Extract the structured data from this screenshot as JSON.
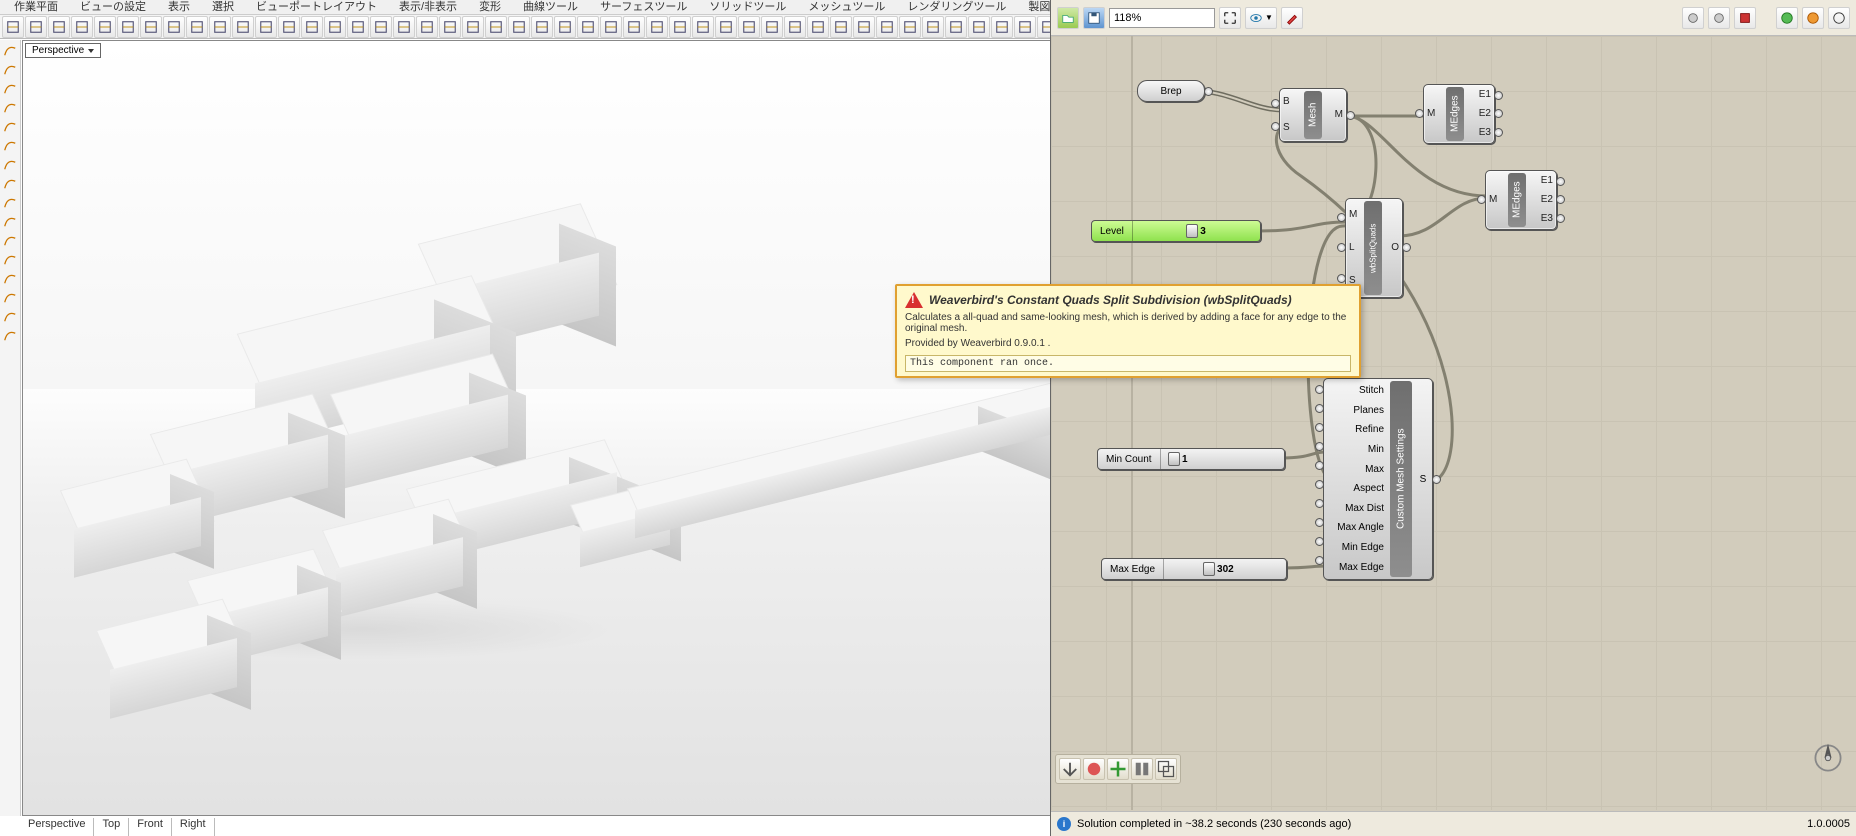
{
  "rhino_menu": [
    "作業平面",
    "ビューの設定",
    "表示",
    "選択",
    "ビューポートレイアウト",
    "表示/非表示",
    "変形",
    "曲線ツール",
    "サーフェスツール",
    "ソリッドツール",
    "メッシュツール",
    "レンダリングツール",
    "製図"
  ],
  "viewport_label": "Perspective",
  "bottom_tabs": [
    "Perspective",
    "Top",
    "Front",
    "Right"
  ],
  "tooltip": {
    "title": "Weaverbird's Constant Quads Split Subdivision (wbSplitQuads)",
    "desc": "Calculates a all-quad and same-looking mesh, which is derived by adding a face for any edge to the original mesh.",
    "provider": "Provided by Weaverbird 0.9.0.1 .",
    "ran": "This component ran once."
  },
  "gh": {
    "zoom": "118%",
    "status": "Solution completed in ~38.2 seconds (230 seconds ago)",
    "version": "1.0.0005"
  },
  "nodes": {
    "brep": "Brep",
    "mesh": {
      "name": "Mesh",
      "in": [
        "B",
        "S"
      ],
      "out": [
        "M"
      ]
    },
    "medges1": {
      "name": "MEdges",
      "in": [
        "M"
      ],
      "out": [
        "E1",
        "E2",
        "E3"
      ]
    },
    "medges2": {
      "name": "MEdges",
      "in": [
        "M"
      ],
      "out": [
        "E1",
        "E2",
        "E3"
      ]
    },
    "split": {
      "name": "wbSplitQuads",
      "in": [
        "M",
        "L",
        "S"
      ],
      "out": [
        "O"
      ]
    },
    "level": {
      "label": "Level",
      "value": "3"
    },
    "mincount": {
      "label": "Min Count",
      "value": "1"
    },
    "maxedge": {
      "label": "Max Edge",
      "value": "302"
    },
    "meshsettings": {
      "name": "Custom Mesh Settings",
      "inputs": [
        "Stitch",
        "Planes",
        "Refine",
        "Min",
        "Max",
        "Aspect",
        "Max Dist",
        "Max Angle",
        "Min Edge",
        "Max Edge"
      ],
      "out": "S"
    }
  }
}
